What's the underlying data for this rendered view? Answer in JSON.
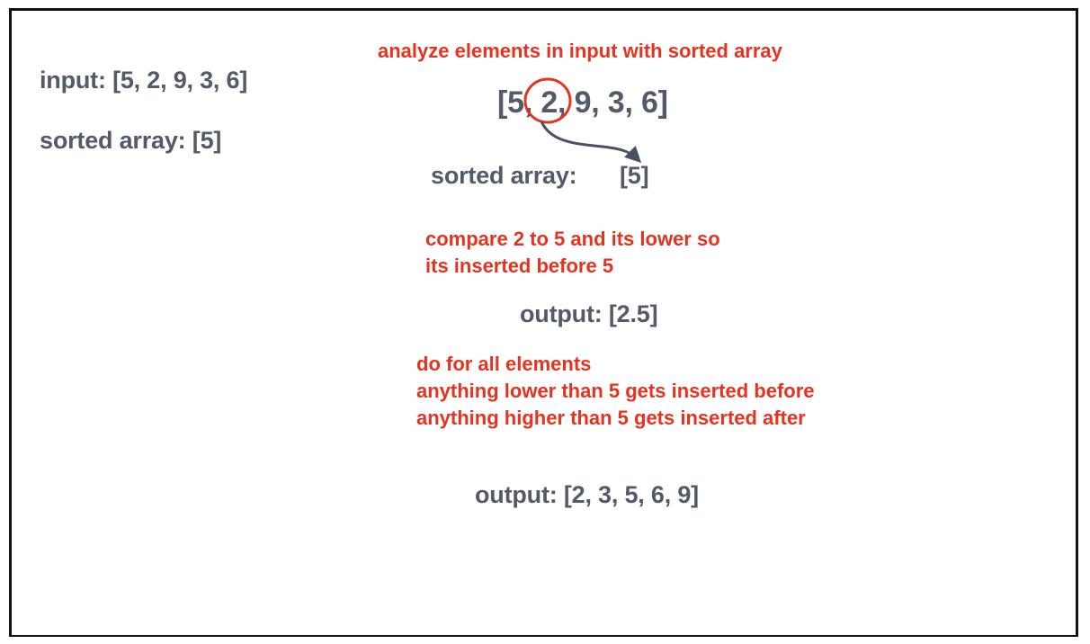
{
  "left_panel": {
    "input_line": "input: [5, 2, 9, 3, 6]",
    "sorted_line": "sorted array: [5]"
  },
  "diagram": {
    "heading": "analyze elements in input with sorted array",
    "array": {
      "open_bracket": "[",
      "first": "5,",
      "highlighted": "2,",
      "rest": "9, 3, 6]"
    },
    "sorted_label": "sorted array:",
    "sorted_value": "[5]",
    "compare_note": [
      "compare 2 to 5 and its lower so",
      "its inserted before 5"
    ],
    "intermediate_output": "output: [2.5]",
    "rule_note": [
      "do for all elements",
      "anything lower than 5 gets inserted before",
      "anything higher than 5 gets inserted after"
    ],
    "final_output": "output: [2, 3, 5, 6, 9]"
  },
  "colors": {
    "text_gray": "#535a68",
    "annotation_red": "#e5331f",
    "frame_border": "#111111",
    "arrow": "#4a5262"
  }
}
